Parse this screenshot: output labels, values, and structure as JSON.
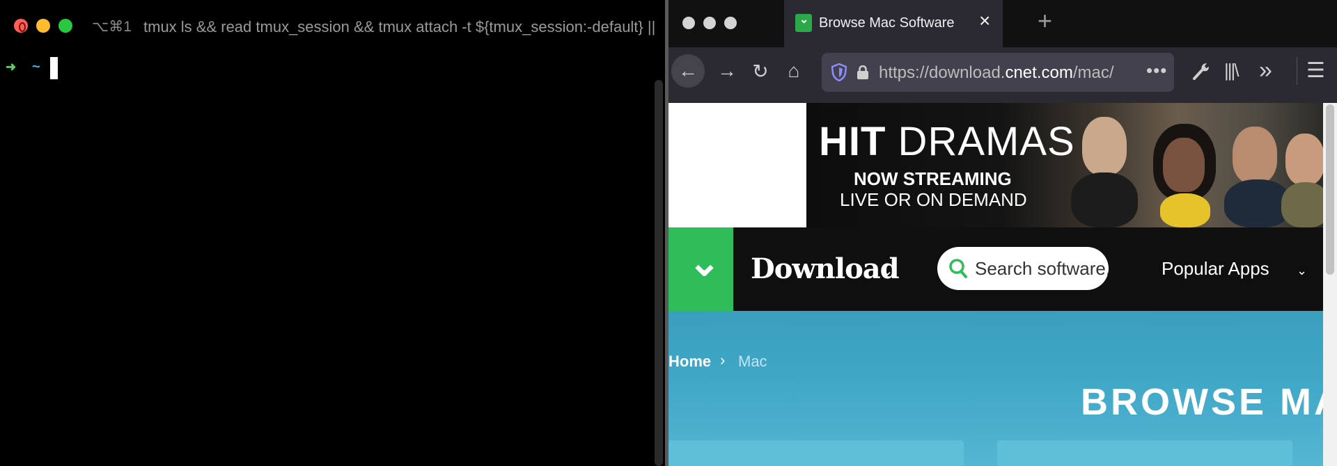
{
  "terminal": {
    "shortcut": "⌥⌘1",
    "title": "tmux ls && read tmux_session && tmux attach -t ${tmux_session:-default} ||",
    "prompt_arrow": "➜",
    "prompt_dir": "~"
  },
  "browser": {
    "tab": {
      "title": "Browse Mac Software",
      "close": "×",
      "new_tab": "+"
    },
    "toolbar": {
      "back": "←",
      "forward": "→",
      "reload": "↻",
      "home": "⌂",
      "url_prefix": "https://download.",
      "url_domain": "cnet.com",
      "url_path": "/mac/",
      "more": "•••",
      "wrench": "🔧",
      "library": "|||\\",
      "overflow": "»",
      "menu": "☰"
    },
    "ad": {
      "hit": "HIT",
      "dramas": " DRAMAS",
      "line2": "NOW STREAMING",
      "line3": "LIVE OR ON DEMAND"
    },
    "site_header": {
      "download_label": "Download",
      "download_caret": "⌄",
      "search_placeholder": "Search software,",
      "popular_apps": "Popular Apps",
      "popular_caret": "⌄"
    },
    "hero": {
      "breadcrumb_home": "Home",
      "breadcrumb_sep": "›",
      "breadcrumb_current": "Mac",
      "title": "BROWSE MAC"
    }
  },
  "colors": {
    "cnet_green": "#2ebd59",
    "hero_blue": "#3fa6c6",
    "browser_chrome": "#2b2a33"
  }
}
